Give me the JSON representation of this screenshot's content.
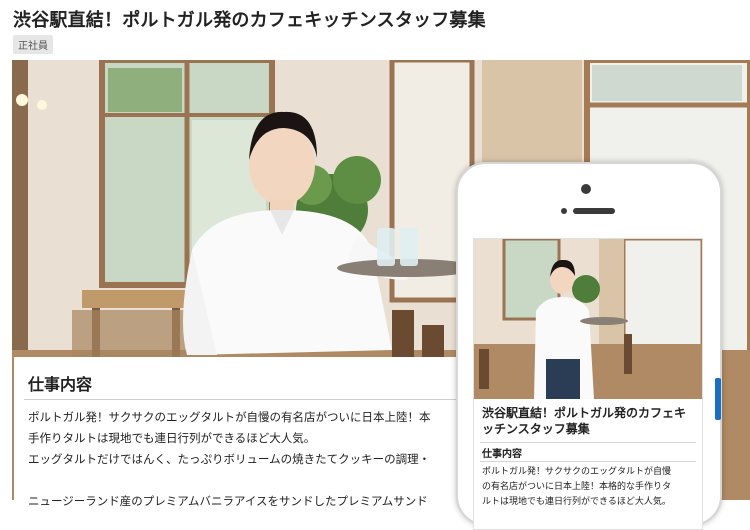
{
  "job": {
    "title": "渋谷駅直結！ポルトガル発のカフェキッチンスタッフ募集",
    "employment_tag": "正社員"
  },
  "section": {
    "heading": "仕事内容",
    "lines": [
      "ポルトガル発！サクサクのエッグタルトが自慢の有名店がついに日本上陸！本",
      "手作りタルトは現地でも連日行列ができるほど大人気。",
      "エッグタルトだけではんく、たっぷりボリュームの焼きたてクッキーの調理・",
      "ニュージーランド産のプレミアムバニラアイスをサンドしたプレミアムサンド"
    ]
  },
  "mobile": {
    "title": "渋谷駅直結！ポルトガル発のカフェキッチンスタッフ募集",
    "heading": "仕事内容",
    "lines": [
      "ポルトガル発！サクサクのエッグタルトが自慢",
      "の有名店がついに日本上陸！本格的な手作りタ",
      "ルトは現地でも連日行列ができるほど大人気。"
    ]
  },
  "colors": {
    "accent": "#1a6fc0",
    "tag_bg": "#e6e6e6"
  },
  "icons": {
    "hero": "cafe-staff-photo",
    "phone": "smartphone-mockup"
  }
}
